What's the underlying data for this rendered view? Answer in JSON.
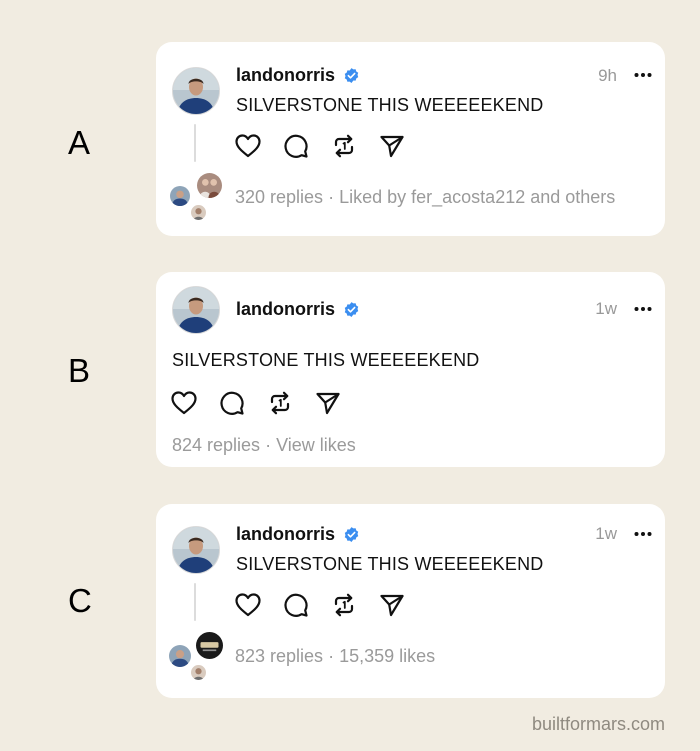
{
  "variants": [
    {
      "label": "A",
      "username": "landonorris",
      "time": "9h",
      "text": "SILVERSTONE THIS WEEEEEKEND",
      "replies": "320 replies",
      "separator": "·",
      "likes": "Liked by fer_acosta212 and others"
    },
    {
      "label": "B",
      "username": "landonorris",
      "time": "1w",
      "text": "SILVERSTONE THIS WEEEEEKEND",
      "replies": "824 replies",
      "separator": "·",
      "likes": "View likes"
    },
    {
      "label": "C",
      "username": "landonorris",
      "time": "1w",
      "text": "SILVERSTONE THIS WEEEEEKEND",
      "replies": "823 replies",
      "separator": "·",
      "likes": "15,359 likes"
    }
  ],
  "icons": {
    "verified": "verified-badge-icon",
    "more": "more-options-icon",
    "like": "heart-icon",
    "reply": "comment-bubble-icon",
    "repost": "repost-icon",
    "share": "send-icon"
  },
  "colors": {
    "background": "#f1ece1",
    "card": "#ffffff",
    "verified": "#3b8ef0",
    "meta_text": "#9a9a9a"
  },
  "watermark": "builtformars.com"
}
